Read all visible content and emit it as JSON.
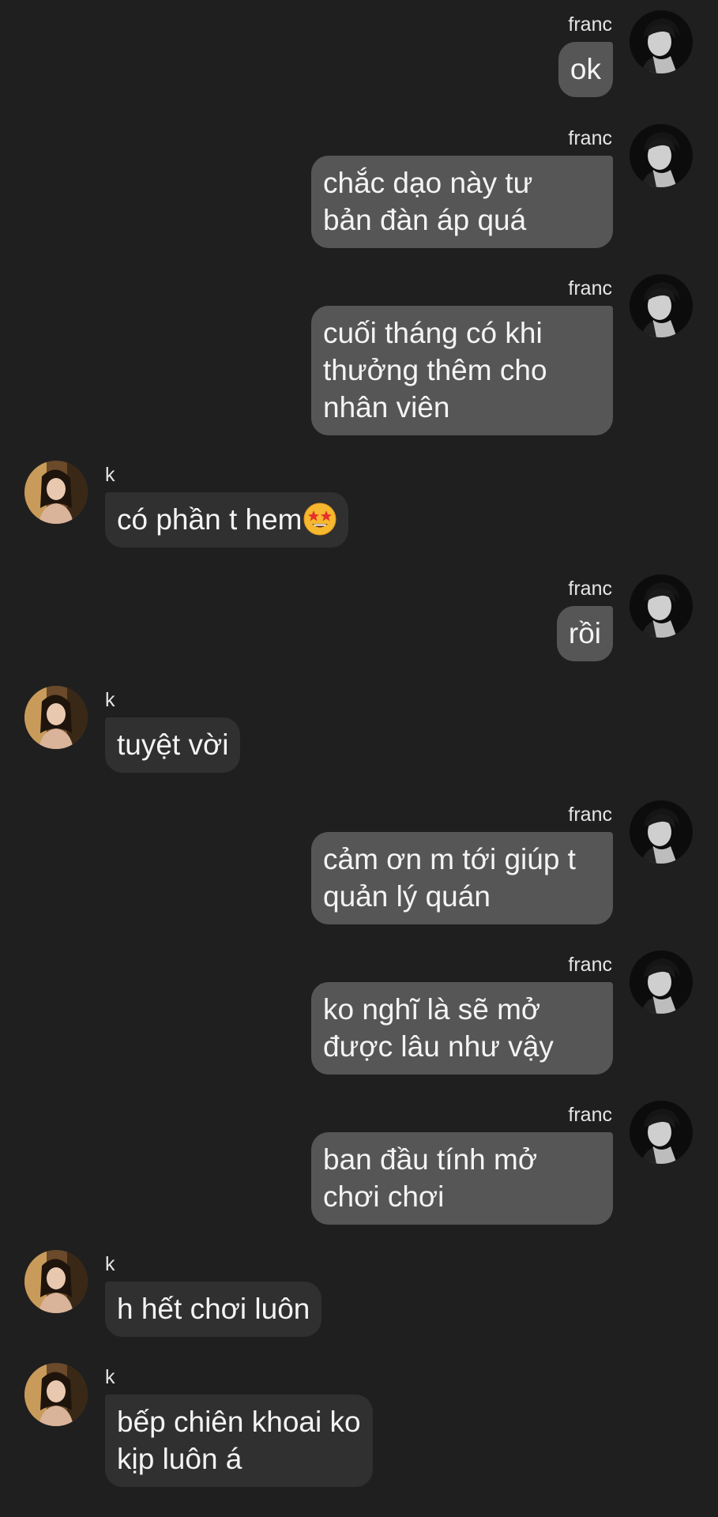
{
  "conversation": {
    "messages": [
      {
        "sender": "franc",
        "text": "ok"
      },
      {
        "sender": "franc",
        "text": "chắc dạo này tư\nbản đàn áp quá"
      },
      {
        "sender": "franc",
        "text": "cuối tháng có khi\nthưởng thêm cho\nnhân viên"
      },
      {
        "sender": "k",
        "text": "có phần t hem",
        "emoji": "star-struck-emoji"
      },
      {
        "sender": "franc",
        "text": "rồi"
      },
      {
        "sender": "k",
        "text": "tuyệt vời"
      },
      {
        "sender": "franc",
        "text": "cảm ơn m tới giúp t\nquản lý quán"
      },
      {
        "sender": "franc",
        "text": "ko nghĩ là sẽ mở\nđược lâu như vậy"
      },
      {
        "sender": "franc",
        "text": "ban đầu tính mở\nchơi chơi"
      },
      {
        "sender": "k",
        "text": "h hết chơi luôn"
      },
      {
        "sender": "k",
        "text": "bếp chiên khoai ko\nkịp luôn á"
      }
    ]
  },
  "colors": {
    "background": "#1f1f1f",
    "outgoing_bubble": "#565656",
    "incoming_bubble": "#303030",
    "text": "#f4f4f4"
  }
}
